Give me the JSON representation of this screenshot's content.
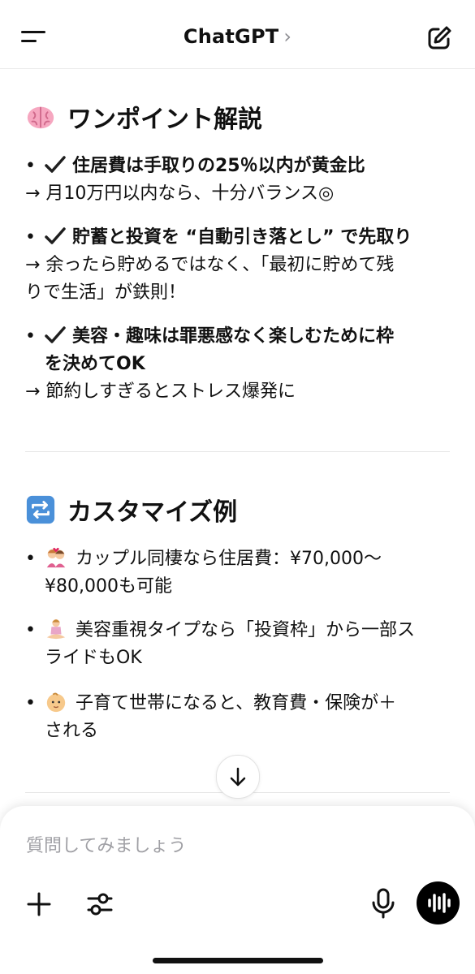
{
  "header": {
    "title": "ChatGPT",
    "title_chevron": "›",
    "menu_icon": "menu-icon",
    "compose_icon": "compose-icon"
  },
  "section1": {
    "title": "ワンポイント解説",
    "emoji": "brain-emoji",
    "items": [
      {
        "bullet": "•",
        "bold": "住居費は手取りの25％以内が黄金比",
        "sub": "→ 月10万円以内なら、十分バランス◎"
      },
      {
        "bullet": "•",
        "bold": "貯蓄と投資を “自動引き落とし” で先取り",
        "sub_line1": "→ 余ったら貯めるではなく、「最初に貯めて残",
        "sub_line2": "りで生活」が鉄則！"
      },
      {
        "bullet": "•",
        "bold_line1": "美容・趣味は罪悪感なく楽しむために枠",
        "bold_line2": "を決めてOK",
        "sub": "→ 節約しすぎるとストレス爆発に"
      }
    ]
  },
  "section2": {
    "title": "カスタマイズ例",
    "emoji": "repeat-emoji",
    "items": [
      {
        "bullet": "•",
        "emoji": "couple-emoji",
        "line1": "カップル同棲なら住居費：¥70,000～",
        "line2": "¥80,000も可能"
      },
      {
        "bullet": "•",
        "emoji": "meditation-emoji",
        "line1": "美容重視タイプなら「投資枠」から一部ス",
        "line2": "ライドもOK"
      },
      {
        "bullet": "•",
        "emoji": "baby-emoji",
        "line1": "子育て世帯になると、教育費・保険が＋",
        "line2": "される"
      }
    ]
  },
  "composer": {
    "placeholder": "質問してみましょう",
    "value": ""
  },
  "colors": {
    "text": "#111111",
    "placeholder": "#a0a0a5",
    "check": "#1f1f1f",
    "accent": "#000000"
  }
}
